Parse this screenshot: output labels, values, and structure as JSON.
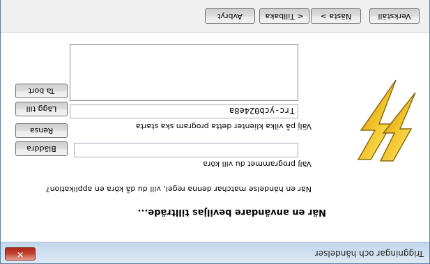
{
  "window": {
    "title": "Triggningar och händelser",
    "close_glyph": "✕"
  },
  "icon": {
    "name": "lightning-bolt-icon",
    "colors": [
      "#f6d23a",
      "#e09a1a",
      "#8a6a10"
    ]
  },
  "form": {
    "heading": "När en användare beviljas tillträde...",
    "question": "När en händelse matchar denna regel, vill du då köra en applikation?",
    "program_label": "Välj programmet du vill köra",
    "program_value": "",
    "browse_label": "Bläddra",
    "clients_label": "Välj på vilka klienter detta program ska starta",
    "clear_label": "Rensa",
    "client_value": "Trc-ycb024e8a",
    "add_label": "Lägg till",
    "remove_label": "Ta bort",
    "client_list": []
  },
  "footer": {
    "cancel_label": "Avbryt",
    "back_label": "< Tillbaka",
    "next_label": "Nästa >",
    "execute_label": "Verkställ"
  }
}
